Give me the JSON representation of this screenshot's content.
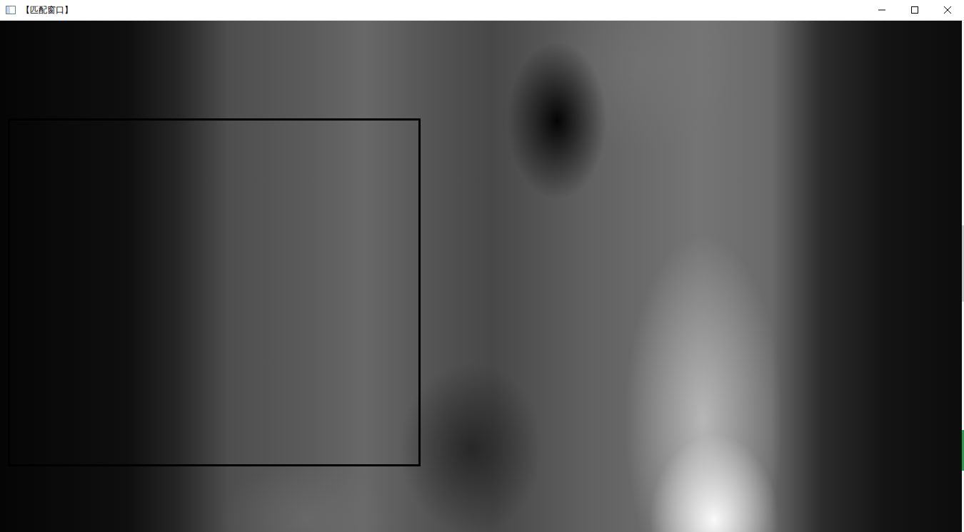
{
  "window": {
    "title": "【匹配窗口】"
  },
  "image": {
    "kind": "grayscale-match-result",
    "marked": true
  }
}
